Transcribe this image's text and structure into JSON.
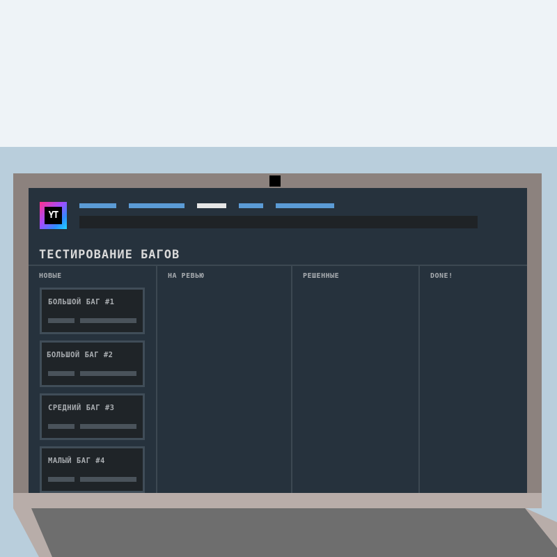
{
  "colors": {
    "sky": "#eef3f7",
    "wall": "#b9cedc",
    "laptop_lid": "#8c827e",
    "screen_bg": "#26323d",
    "nav_link": "#5b9bd5",
    "nav_active": "#e6e6e6",
    "card_border": "#404d58"
  },
  "app": {
    "logo_text": "YT",
    "nav_items": [
      {
        "label": "",
        "active": false
      },
      {
        "label": "",
        "active": false
      },
      {
        "label": "",
        "active": true
      },
      {
        "label": "",
        "active": false
      },
      {
        "label": "",
        "active": false
      }
    ],
    "search": {
      "value": ""
    },
    "title": "ТЕСТИРОВАНИЕ БАГОВ"
  },
  "board": {
    "columns": [
      {
        "title": "НОВЫЕ"
      },
      {
        "title": "НА РЕВЬЮ"
      },
      {
        "title": "РЕШЕННЫЕ"
      },
      {
        "title": "DONE!"
      }
    ],
    "cards": [
      {
        "title": "БОЛЬШОЙ БАГ #1"
      },
      {
        "title": "БОЛЬШОЙ БАГ #2"
      },
      {
        "title": "СРЕДНИЙ БАГ #3"
      },
      {
        "title": "МАЛЫЙ БАГ #4"
      }
    ]
  }
}
